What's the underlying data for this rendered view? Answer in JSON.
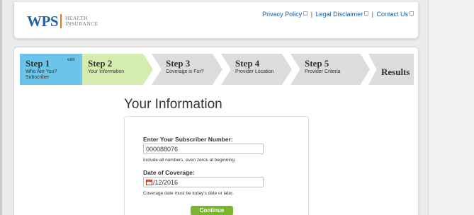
{
  "brand": {
    "name": "WPS",
    "tagline_line1": "HEALTH",
    "tagline_line2": "INSURANCE"
  },
  "top_links": [
    "Privacy Policy",
    "Legal Disclaimer",
    "Contact Us"
  ],
  "steps": [
    {
      "title": "Step 1",
      "subtitle_line1": "Who Are You?",
      "subtitle_line2": "Subscriber",
      "edit": "edit",
      "state": "complete"
    },
    {
      "title": "Step 2",
      "subtitle_line1": "Your Information",
      "state": "current"
    },
    {
      "title": "Step 3",
      "subtitle_line1": "Coverage is For?",
      "state": "upcoming"
    },
    {
      "title": "Step 4",
      "subtitle_line1": "Provider Location",
      "state": "upcoming"
    },
    {
      "title": "Step 5",
      "subtitle_line1": "Provider Criteria",
      "state": "upcoming"
    },
    {
      "title": "Results",
      "state": "upcoming"
    }
  ],
  "section_title": "Your Information",
  "form": {
    "subscriber_label": "Enter Your Subscriber Number:",
    "subscriber_value": "000088076",
    "subscriber_hint": "Include all numbers, even zeros at beginning.",
    "date_label": "Date of Coverage:",
    "date_value": "01/12/2016",
    "date_hint": "Coverage date must be today's date or later.",
    "continue_label": "Continue"
  },
  "colors": {
    "brand_blue": "#1d5fa8",
    "brand_orange": "#e8761c",
    "step_complete": "#6cc4ea",
    "step_current": "#d5ecb0",
    "step_upcoming": "#dcdcdc",
    "button_green": "#7ab62e"
  }
}
